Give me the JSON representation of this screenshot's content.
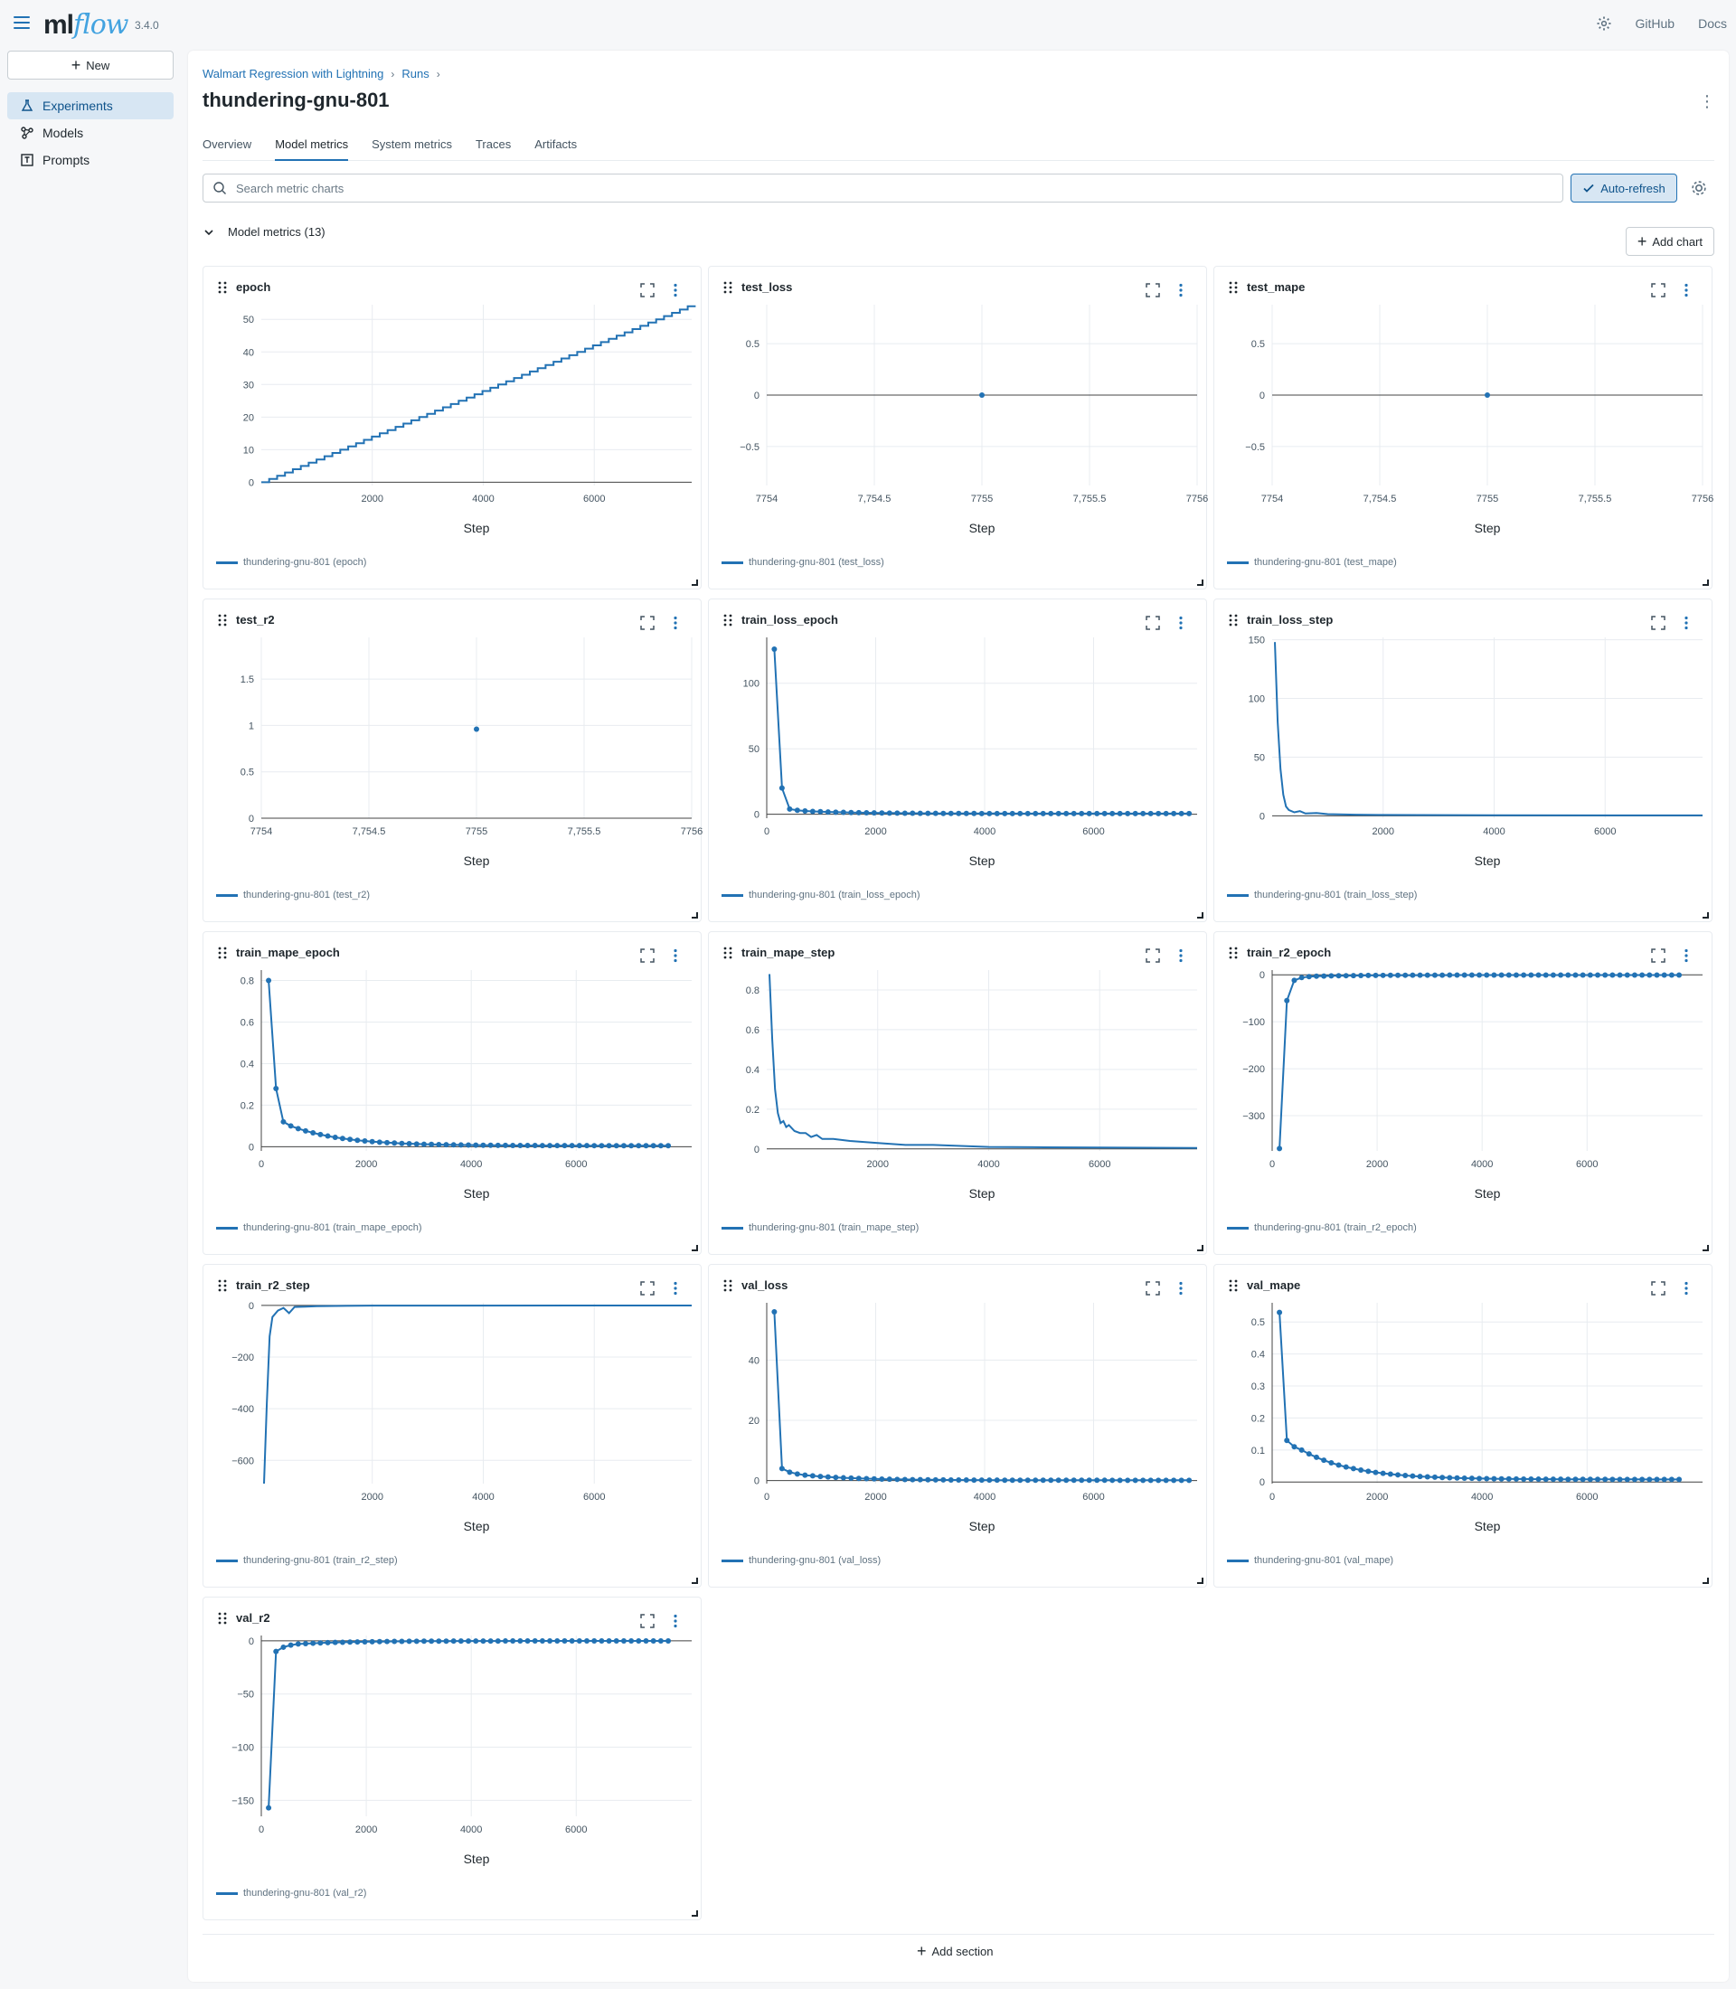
{
  "app": {
    "logo_ml": "ml",
    "logo_flow": "flow",
    "version": "3.4.0",
    "github": "GitHub",
    "docs": "Docs"
  },
  "sidebar": {
    "new_label": "New",
    "items": [
      {
        "label": "Experiments",
        "icon": "beaker-icon"
      },
      {
        "label": "Models",
        "icon": "models-icon"
      },
      {
        "label": "Prompts",
        "icon": "prompt-icon"
      }
    ]
  },
  "breadcrumb": [
    "Walmart Regression with Lightning",
    "Runs"
  ],
  "page_title": "thundering-gnu-801",
  "tabs": [
    "Overview",
    "Model metrics",
    "System metrics",
    "Traces",
    "Artifacts"
  ],
  "active_tab": "Model metrics",
  "search": {
    "placeholder": "Search metric charts"
  },
  "auto_refresh_label": "Auto-refresh",
  "section": {
    "title": "Model metrics (13)",
    "add_chart": "Add chart",
    "add_section": "Add section"
  },
  "colors": {
    "accent": "#2272b4",
    "grid": "#e8ecf0"
  },
  "chart_data": [
    {
      "type": "line",
      "title": "epoch",
      "xlabel": "Step",
      "legend": "thundering-gnu-801 (epoch)",
      "xlim": [
        0,
        7756
      ],
      "ylim": [
        -1,
        54.5
      ],
      "xticks": [
        2000,
        4000,
        6000
      ],
      "yticks": [
        0,
        10,
        20,
        30,
        40,
        50
      ],
      "markers": false,
      "staircase": true,
      "x": [
        0,
        7756
      ],
      "y": [
        0,
        54
      ]
    },
    {
      "type": "scatter",
      "title": "test_loss",
      "xlabel": "Step",
      "legend": "thundering-gnu-801 (test_loss)",
      "xlim": [
        7754,
        7756
      ],
      "ylim": [
        -0.88,
        0.88
      ],
      "xticks": [
        7754,
        7754.5,
        7755,
        7755.5,
        7756
      ],
      "xtick_labels": [
        "7754",
        "7,754.5",
        "7755",
        "7,755.5",
        "7756"
      ],
      "yticks": [
        0.5,
        0,
        -0.5
      ],
      "ytick_labels": [
        "0.5",
        "0",
        "−0.5"
      ],
      "zero_line": true,
      "x": [
        7755
      ],
      "y": [
        0
      ]
    },
    {
      "type": "scatter",
      "title": "test_mape",
      "xlabel": "Step",
      "legend": "thundering-gnu-801 (test_mape)",
      "xlim": [
        7754,
        7756
      ],
      "ylim": [
        -0.88,
        0.88
      ],
      "xticks": [
        7754,
        7754.5,
        7755,
        7755.5,
        7756
      ],
      "xtick_labels": [
        "7754",
        "7,754.5",
        "7755",
        "7,755.5",
        "7756"
      ],
      "yticks": [
        0.5,
        0,
        -0.5
      ],
      "ytick_labels": [
        "0.5",
        "0",
        "−0.5"
      ],
      "zero_line": true,
      "x": [
        7755
      ],
      "y": [
        0
      ]
    },
    {
      "type": "scatter",
      "title": "test_r2",
      "xlabel": "Step",
      "legend": "thundering-gnu-801 (test_r2)",
      "xlim": [
        7754,
        7756
      ],
      "ylim": [
        0,
        1.95
      ],
      "xticks": [
        7754,
        7754.5,
        7755,
        7755.5,
        7756
      ],
      "xtick_labels": [
        "7754",
        "7,754.5",
        "7755",
        "7,755.5",
        "7756"
      ],
      "yticks": [
        0,
        0.5,
        1,
        1.5
      ],
      "ytick_labels": [
        "0",
        "0.5",
        "1",
        "1.5"
      ],
      "x": [
        7755
      ],
      "y": [
        0.96
      ]
    },
    {
      "type": "line",
      "title": "train_loss_epoch",
      "xlabel": "Step",
      "legend": "thundering-gnu-801 (train_loss_epoch)",
      "xlim": [
        0,
        7900
      ],
      "ylim": [
        -3,
        135
      ],
      "xticks": [
        0,
        2000,
        4000,
        6000
      ],
      "yticks": [
        0,
        50,
        100
      ],
      "markers": true,
      "decay": {
        "x0": 139,
        "dx": 141,
        "n": 55,
        "values_head": [
          126,
          20,
          4,
          3,
          2.5,
          2.2
        ],
        "tail": 0.5
      }
    },
    {
      "type": "line",
      "title": "train_loss_step",
      "xlabel": "Step",
      "legend": "thundering-gnu-801 (train_loss_step)",
      "xlim": [
        0,
        7756
      ],
      "ylim": [
        -2,
        152
      ],
      "xticks": [
        2000,
        4000,
        6000
      ],
      "yticks": [
        0,
        50,
        100,
        150
      ],
      "markers": false,
      "x": [
        49,
        100,
        150,
        200,
        250,
        300,
        400,
        500,
        600,
        800,
        1000,
        1500,
        2000,
        4000,
        7756
      ],
      "y": [
        148,
        80,
        40,
        18,
        8,
        5,
        3,
        4,
        2,
        2.5,
        1.5,
        1,
        0.8,
        0.5,
        0.4
      ]
    },
    {
      "type": "line",
      "title": "train_mape_epoch",
      "xlabel": "Step",
      "legend": "thundering-gnu-801 (train_mape_epoch)",
      "xlim": [
        0,
        8200
      ],
      "ylim": [
        -0.02,
        0.85
      ],
      "xticks": [
        0,
        2000,
        4000,
        6000
      ],
      "yticks": [
        0,
        0.2,
        0.4,
        0.6,
        0.8
      ],
      "markers": true,
      "decay": {
        "x0": 139,
        "dx": 141,
        "n": 55,
        "values_head": [
          0.8,
          0.28,
          0.12,
          0.1
        ],
        "tail": 0.005
      }
    },
    {
      "type": "line",
      "title": "train_mape_step",
      "xlabel": "Step",
      "legend": "thundering-gnu-801 (train_mape_step)",
      "xlim": [
        0,
        7756
      ],
      "ylim": [
        -0.01,
        0.9
      ],
      "xticks": [
        2000,
        4000,
        6000
      ],
      "yticks": [
        0,
        0.2,
        0.4,
        0.6,
        0.8
      ],
      "markers": false,
      "x": [
        49,
        100,
        150,
        200,
        250,
        300,
        350,
        400,
        500,
        600,
        700,
        800,
        900,
        1000,
        1200,
        1500,
        2000,
        2500,
        3000,
        4000,
        5000,
        7756
      ],
      "y": [
        0.88,
        0.55,
        0.3,
        0.18,
        0.13,
        0.14,
        0.11,
        0.12,
        0.09,
        0.08,
        0.08,
        0.06,
        0.07,
        0.05,
        0.05,
        0.04,
        0.03,
        0.02,
        0.02,
        0.01,
        0.008,
        0.005
      ]
    },
    {
      "type": "line",
      "title": "train_r2_epoch",
      "xlabel": "Step",
      "legend": "thundering-gnu-801 (train_r2_epoch)",
      "xlim": [
        0,
        8200
      ],
      "ylim": [
        -375,
        10
      ],
      "xticks": [
        0,
        2000,
        4000,
        6000
      ],
      "yticks": [
        0,
        -100,
        -200,
        -300
      ],
      "ytick_labels": [
        "0",
        "−100",
        "−200",
        "−300"
      ],
      "markers": true,
      "decay": {
        "x0": 139,
        "dx": 141,
        "n": 55,
        "values_head": [
          -370,
          -55,
          -12,
          -6,
          -4,
          -3
        ],
        "tail": -0.5
      }
    },
    {
      "type": "line",
      "title": "train_r2_step",
      "xlabel": "Step",
      "legend": "thundering-gnu-801 (train_r2_step)",
      "xlim": [
        0,
        7756
      ],
      "ylim": [
        -690,
        10
      ],
      "xticks": [
        2000,
        4000,
        6000
      ],
      "yticks": [
        0,
        -200,
        -400,
        -600
      ],
      "ytick_labels": [
        "0",
        "−200",
        "−400",
        "−600"
      ],
      "markers": false,
      "x": [
        49,
        100,
        150,
        200,
        300,
        400,
        500,
        600,
        800,
        1000,
        2000,
        7756
      ],
      "y": [
        -690,
        -380,
        -120,
        -45,
        -20,
        -10,
        -30,
        -6,
        -5,
        -3,
        -1,
        -0.5
      ]
    },
    {
      "type": "line",
      "title": "val_loss",
      "xlabel": "Step",
      "legend": "thundering-gnu-801 (val_loss)",
      "xlim": [
        0,
        7900
      ],
      "ylim": [
        -1,
        59
      ],
      "xticks": [
        0,
        2000,
        4000,
        6000
      ],
      "yticks": [
        0,
        20,
        40
      ],
      "markers": true,
      "decay": {
        "x0": 139,
        "dx": 141,
        "n": 55,
        "values_head": [
          56,
          4,
          2.8,
          2.2,
          1.8
        ],
        "tail": 0.1
      }
    },
    {
      "type": "line",
      "title": "val_mape",
      "xlabel": "Step",
      "legend": "thundering-gnu-801 (val_mape)",
      "xlim": [
        0,
        8200
      ],
      "ylim": [
        -0.005,
        0.56
      ],
      "xticks": [
        0,
        2000,
        4000,
        6000
      ],
      "yticks": [
        0,
        0.1,
        0.2,
        0.3,
        0.4,
        0.5
      ],
      "markers": true,
      "decay": {
        "x0": 139,
        "dx": 141,
        "n": 55,
        "values_head": [
          0.53,
          0.13,
          0.11,
          0.1
        ],
        "tail": 0.008
      }
    },
    {
      "type": "line",
      "title": "val_r2",
      "xlabel": "Step",
      "legend": "thundering-gnu-801 (val_r2)",
      "xlim": [
        0,
        8200
      ],
      "ylim": [
        -165,
        5
      ],
      "xticks": [
        0,
        2000,
        4000,
        6000
      ],
      "yticks": [
        0,
        -50,
        -100,
        -150
      ],
      "ytick_labels": [
        "0",
        "−50",
        "−100",
        "−150"
      ],
      "markers": true,
      "decay": {
        "x0": 139,
        "dx": 141,
        "n": 55,
        "values_head": [
          -157,
          -10,
          -6,
          -4,
          -3
        ],
        "tail": -0.1
      }
    }
  ]
}
